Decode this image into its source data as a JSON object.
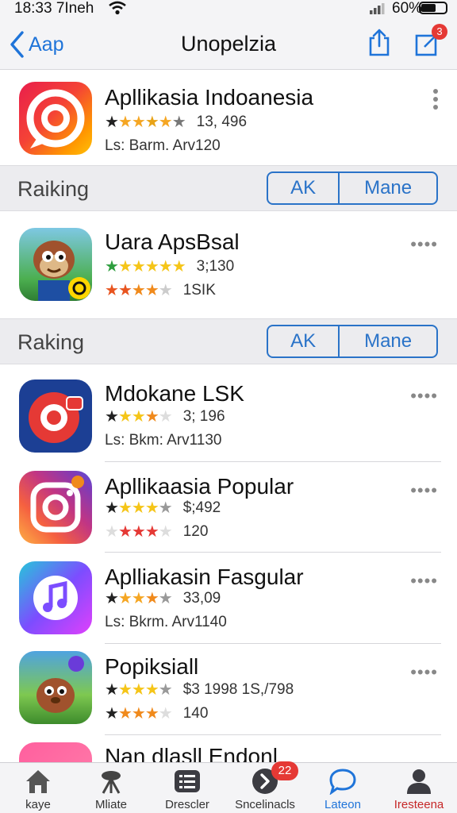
{
  "status_bar": {
    "time": "18:33 7Ineh",
    "battery_text": "60%"
  },
  "nav": {
    "back_label": "Aap",
    "title": "Unopelzia",
    "edit_badge": "3"
  },
  "colors": {
    "accent": "#1f74d9",
    "badge": "#e53935",
    "section_bg": "#ececef"
  },
  "apps": [
    {
      "name": "Apllikasia Indoanesia",
      "rating_count": "13, 496",
      "line3": "Ls: Barm. Arv120",
      "icon": "red-camera-circle-icon"
    },
    {
      "name": "Uara ApsBsal",
      "rating_count": "3;130",
      "line3": "1SIK",
      "icon": "cartoon-character-icon"
    },
    {
      "name": "Mdokane LSK",
      "rating_count": "3; 196",
      "line3": "Ls: Bkm: Arv1130",
      "icon": "red-ring-icon"
    },
    {
      "name": "Apllikaasia Popular",
      "rating_count": "$;492",
      "line3": "120",
      "icon": "instagram-style-camera-icon"
    },
    {
      "name": "Aplliakasin Fasgular",
      "rating_count": "33,09",
      "line3": "Ls: Bkrm. Arv1140",
      "icon": "music-note-icon"
    },
    {
      "name": "Popiksiall",
      "rating_count": "$3 1998 1S,/798",
      "line3": "140",
      "icon": "brown-creature-icon"
    },
    {
      "name": "Nan dlasll Endonl",
      "icon": "pink-app-icon"
    }
  ],
  "sections": [
    {
      "label": "Raiking",
      "options": [
        "AK",
        "Mane"
      ]
    },
    {
      "label": "Raking",
      "options": [
        "AK",
        "Mane"
      ]
    }
  ],
  "tabs": [
    {
      "label": "kaye",
      "icon": "home-icon"
    },
    {
      "label": "Mliate",
      "icon": "tools-icon"
    },
    {
      "label": "Drescler",
      "icon": "list-icon"
    },
    {
      "label": "Sncelinacls",
      "icon": "arrow-circle-icon",
      "badge": "22"
    },
    {
      "label": "Lateon",
      "icon": "chat-bubble-icon",
      "active": true
    },
    {
      "label": "Iresteena",
      "icon": "person-icon"
    }
  ]
}
